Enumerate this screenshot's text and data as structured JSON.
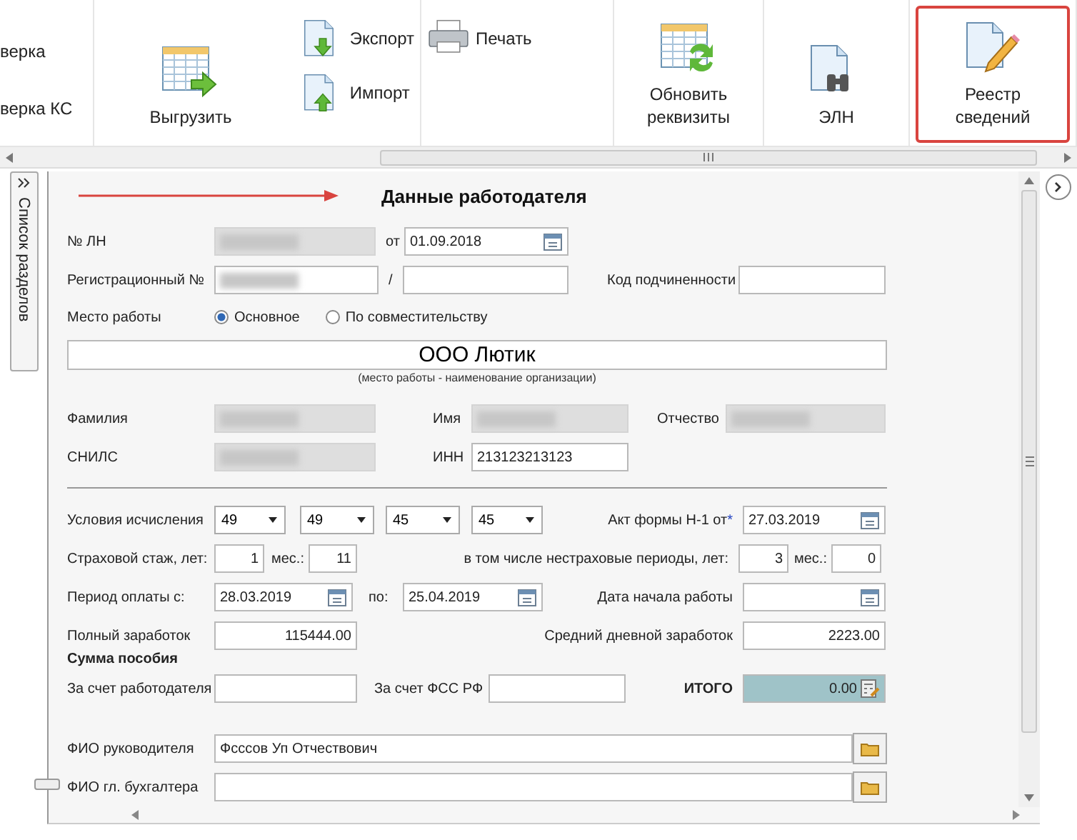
{
  "ribbon": {
    "groups": [
      {
        "items": [
          {
            "kind": "text",
            "label": "верка"
          },
          {
            "kind": "text",
            "label": "верка КС"
          }
        ]
      },
      {
        "items": [
          {
            "kind": "large",
            "label": "Выгрузить",
            "selected": false
          },
          {
            "kind": "small",
            "label": "Экспорт",
            "selected": false
          },
          {
            "kind": "small",
            "label": "Импорт",
            "selected": false
          }
        ]
      },
      {
        "items": [
          {
            "kind": "small",
            "label": "Печать",
            "selected": false
          }
        ]
      },
      {
        "items": [
          {
            "kind": "large",
            "label": "Обновить реквизиты",
            "selected": false
          }
        ]
      },
      {
        "items": [
          {
            "kind": "large",
            "label": "ЭЛН",
            "selected": false
          }
        ]
      },
      {
        "items": [
          {
            "kind": "large",
            "label": "Реестр сведений",
            "selected": true
          }
        ]
      }
    ]
  },
  "side_panel": {
    "label": "Список разделов"
  },
  "form": {
    "title": "Данные работодателя",
    "number": {
      "label": "№ ЛН",
      "redacted": true,
      "disabled": true
    },
    "date_from": {
      "label": "от",
      "value": "01.09.2018"
    },
    "reg_number": {
      "label": "Регистрационный №",
      "redacted": true,
      "disabled": false
    },
    "reg_separator": "/",
    "subordination": {
      "label": "Код подчиненности"
    },
    "workplace": {
      "label": "Место работы",
      "options": [
        {
          "label": "Основное",
          "selected": true
        },
        {
          "label": "По совместительству",
          "selected": false
        }
      ]
    },
    "organization": {
      "value": "ООО Лютик",
      "caption": "(место работы - наименование организации)"
    },
    "surname": {
      "label": "Фамилия",
      "redacted": true,
      "disabled": true
    },
    "name": {
      "label": "Имя",
      "redacted": true,
      "disabled": true
    },
    "patronymic": {
      "label": "Отчество",
      "redacted": true,
      "disabled": true
    },
    "snils": {
      "label": "СНИЛС",
      "redacted": true,
      "disabled": true
    },
    "inn": {
      "label": "ИНН",
      "value": "213123213123"
    },
    "conditions": {
      "label": "Условия исчисления",
      "values": [
        "49",
        "49",
        "45",
        "45"
      ]
    },
    "act_date": {
      "label": "Акт формы Н-1 от",
      "required_mark": "*",
      "value": "27.03.2019"
    },
    "insurance": {
      "label": "Страховой стаж, лет:",
      "years": "1",
      "months_label": "мес.:",
      "months": "11"
    },
    "non_insurance": {
      "label": "в том числе нестраховые периоды, лет:",
      "years": "3",
      "months_label": "мес.:",
      "months": "0"
    },
    "period": {
      "label": "Период оплаты с:",
      "from": "28.03.2019",
      "to_label": "по:",
      "to": "25.04.2019"
    },
    "start_date": {
      "label": "Дата начала работы"
    },
    "full_earnings": {
      "label": "Полный заработок",
      "value": "115444.00"
    },
    "avg_daily": {
      "label": "Средний дневной заработок",
      "value": "2223.00"
    },
    "benefit": {
      "title": "Сумма пособия",
      "employer_label": "За счет работодателя",
      "fss_label": "За счет ФСС РФ",
      "total_label": "ИТОГО",
      "total": "0.00"
    },
    "director": {
      "label": "ФИО руководителя",
      "value": "Фсссов Уп Отчествович"
    },
    "accountant": {
      "label": "ФИО гл. бухгалтера"
    }
  }
}
